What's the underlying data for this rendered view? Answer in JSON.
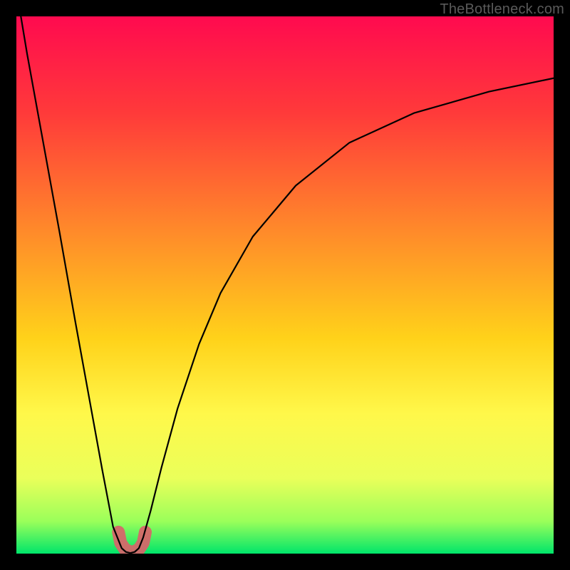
{
  "watermark": "TheBottleneck.com",
  "chart_data": {
    "type": "line",
    "title": "",
    "xlabel": "",
    "ylabel": "",
    "xlim": [
      0,
      1
    ],
    "ylim": [
      0,
      100
    ],
    "series": [
      {
        "name": "curve",
        "x": [
          0.0,
          0.02,
          0.05,
          0.08,
          0.11,
          0.14,
          0.16,
          0.18,
          0.196,
          0.204,
          0.212,
          0.22,
          0.228,
          0.236,
          0.25,
          0.27,
          0.3,
          0.34,
          0.38,
          0.44,
          0.52,
          0.62,
          0.74,
          0.88,
          1.0
        ],
        "y": [
          105.0,
          93.0,
          76.5,
          60.0,
          43.0,
          26.5,
          15.5,
          5.0,
          1.0,
          0.3,
          0.1,
          0.3,
          1.0,
          3.0,
          8.0,
          16.0,
          27.0,
          39.0,
          48.5,
          59.0,
          68.5,
          76.5,
          82.0,
          86.0,
          88.5
        ]
      }
    ],
    "highlight_region": {
      "x": [
        0.19,
        0.24
      ],
      "y_range": [
        0,
        4
      ],
      "color": "#d9636a"
    },
    "background_gradient": {
      "stops": [
        {
          "offset": 0.0,
          "color": "#ff0a4f"
        },
        {
          "offset": 0.18,
          "color": "#ff3a3a"
        },
        {
          "offset": 0.4,
          "color": "#ff8a2a"
        },
        {
          "offset": 0.6,
          "color": "#ffd21a"
        },
        {
          "offset": 0.74,
          "color": "#fff84a"
        },
        {
          "offset": 0.86,
          "color": "#eaff5a"
        },
        {
          "offset": 0.94,
          "color": "#9aff5a"
        },
        {
          "offset": 1.0,
          "color": "#00e56a"
        }
      ]
    }
  }
}
